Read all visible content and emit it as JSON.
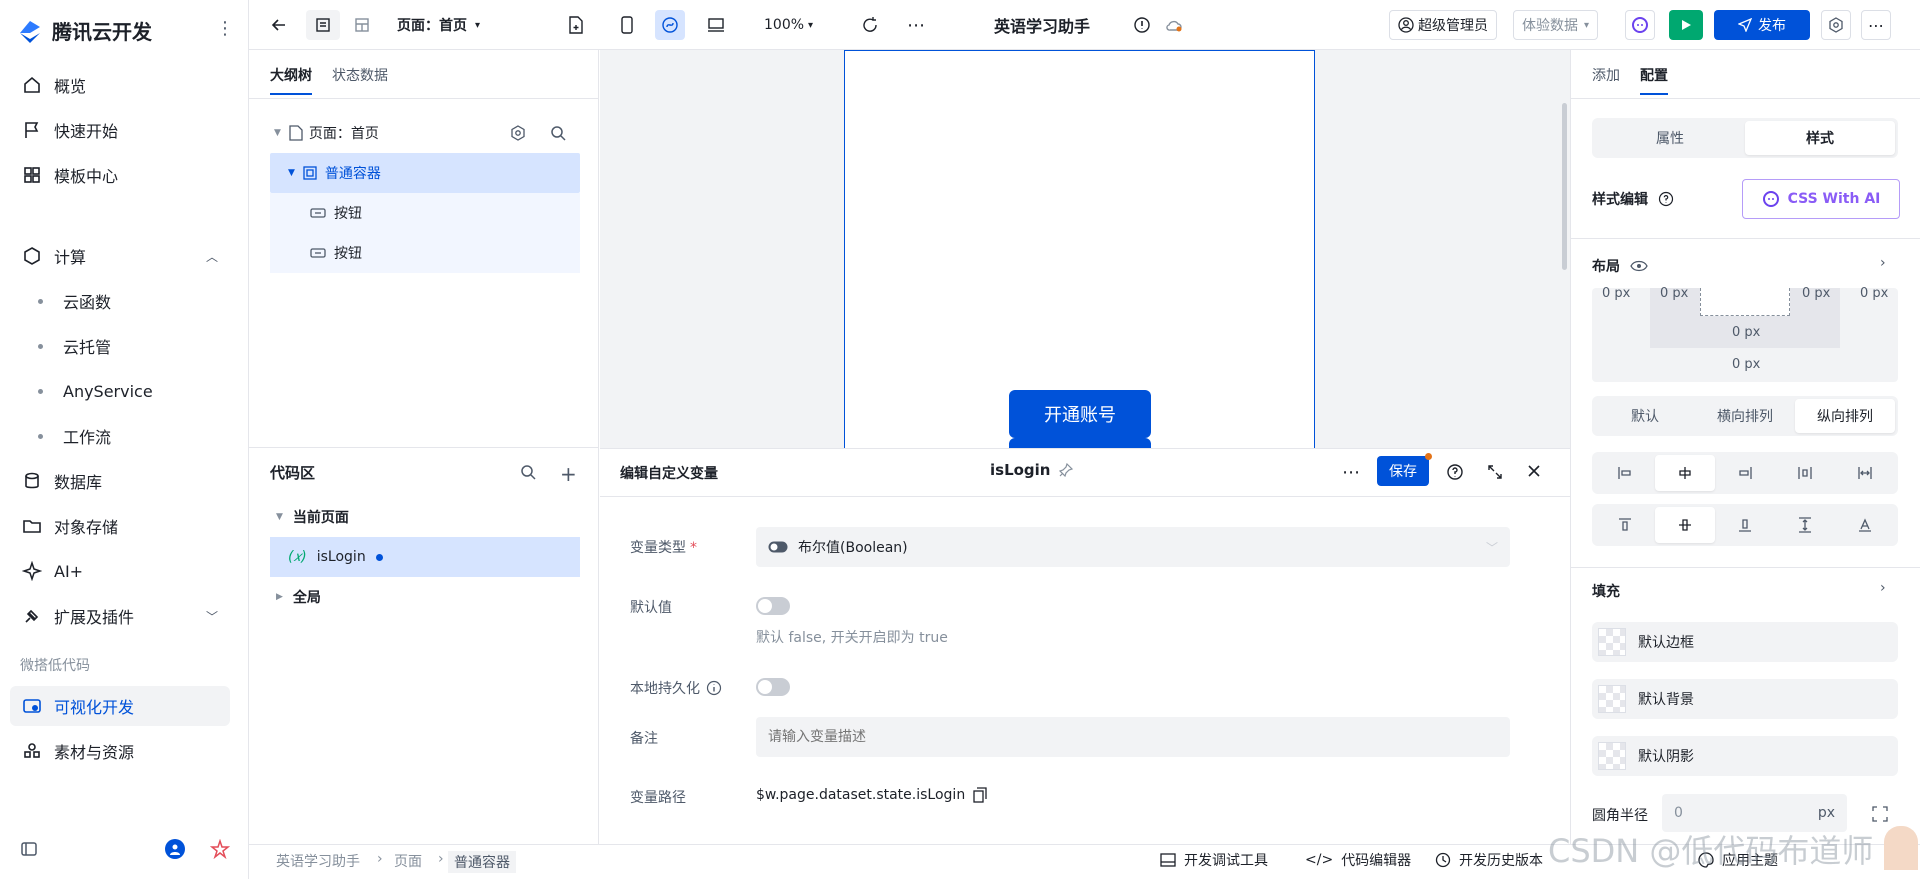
{
  "app": {
    "name": "腾讯云开发"
  },
  "sidebar": {
    "items": [
      {
        "label": "概览"
      },
      {
        "label": "快速开始"
      },
      {
        "label": "模板中心"
      },
      {
        "label": "计算"
      },
      {
        "label": "云函数"
      },
      {
        "label": "云托管"
      },
      {
        "label": "AnyService"
      },
      {
        "label": "工作流"
      },
      {
        "label": "数据库"
      },
      {
        "label": "对象存储"
      },
      {
        "label": "AI+"
      },
      {
        "label": "扩展及插件"
      },
      {
        "label": "可视化开发"
      },
      {
        "label": "素材与资源"
      }
    ],
    "section_label": "微搭低代码"
  },
  "toolbar": {
    "page_select": "页面：首页",
    "zoom": "100%",
    "app_title": "英语学习助手",
    "admin": "超级管理员",
    "data_mode": "体验数据",
    "publish": "发布"
  },
  "outline": {
    "tabs": [
      "大纲树",
      "状态数据"
    ],
    "rows": [
      {
        "label": "页面：首页"
      },
      {
        "label": "普通容器"
      },
      {
        "label": "按钮"
      },
      {
        "label": "按钮"
      }
    ]
  },
  "canvas": {
    "button_label": "开通账号"
  },
  "code_area": {
    "title": "代码区",
    "current_page": "当前页面",
    "variable": "isLogin",
    "global": "全局"
  },
  "editor": {
    "title": "编辑自定义变量",
    "var_name": "isLogin",
    "save": "保存",
    "type_label": "变量类型",
    "type_value": "布尔值(Boolean)",
    "default_label": "默认值",
    "default_hint": "默认 false, 开关开启即为 true",
    "persist_label": "本地持久化",
    "note_label": "备注",
    "note_placeholder": "请输入变量描述",
    "path_label": "变量路径",
    "path_value": "$w.page.dataset.state.isLogin"
  },
  "props": {
    "tabs": [
      "添加",
      "配置"
    ],
    "seg": [
      "属性",
      "样式"
    ],
    "style_edit": "样式编辑",
    "css_ai": "CSS With AI",
    "layout": "布局",
    "box": {
      "left": "0 px",
      "right": "0 px",
      "inner_left": "0 px",
      "inner_right": "0 px",
      "inner_bottom": "0 px",
      "bottom": "0 px"
    },
    "direction": [
      "默认",
      "横向排列",
      "纵向排列"
    ],
    "fill": "填充",
    "fill_rows": [
      "默认边框",
      "默认背景",
      "默认阴影"
    ],
    "radius_label": "圆角半径",
    "radius_value": "0",
    "radius_unit": "px"
  },
  "footer": {
    "breadcrumb": [
      "英语学习助手",
      "页面",
      "普通容器"
    ],
    "tools": [
      "开发调试工具",
      "代码编辑器",
      "开发历史版本",
      "应用主题"
    ]
  },
  "watermark": "CSDN @低代码布道师",
  "colors": {
    "accent": "#0052d9",
    "active_bg": "#d6e4ff",
    "publish": "#0052d9",
    "run": "#00a870"
  }
}
